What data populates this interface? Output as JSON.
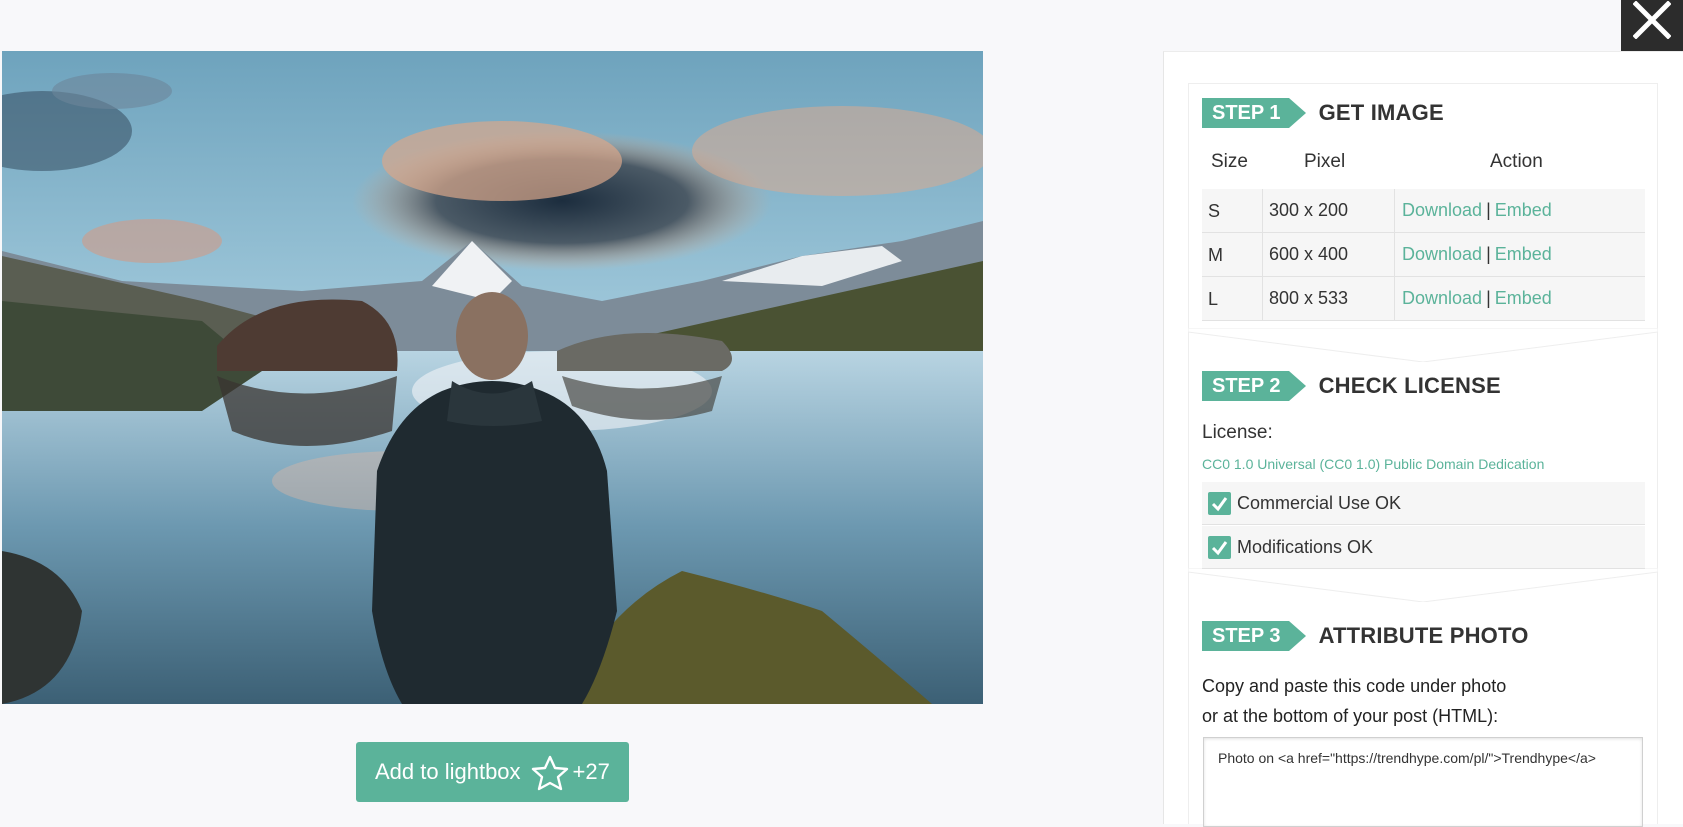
{
  "close": {
    "icon": "close-icon"
  },
  "lightbox": {
    "label": "Add to lightbox",
    "icon": "star-outline-icon",
    "count": "+27"
  },
  "step1": {
    "tag": "STEP 1",
    "title": "GET IMAGE",
    "headers": {
      "size": "Size",
      "pixel": "Pixel",
      "action": "Action"
    },
    "rows": [
      {
        "size": "S",
        "pixel": "300 x 200",
        "download": "Download",
        "sep": "|",
        "embed": "Embed"
      },
      {
        "size": "M",
        "pixel": "600 x 400",
        "download": "Download",
        "sep": "|",
        "embed": "Embed"
      },
      {
        "size": "L",
        "pixel": "800 x 533",
        "download": "Download",
        "sep": "|",
        "embed": "Embed"
      }
    ]
  },
  "step2": {
    "tag": "STEP 2",
    "title": "CHECK LICENSE",
    "license_label": "License:",
    "license_link": "CC0 1.0 Universal (CC0 1.0) Public Domain Dedication",
    "checks": [
      {
        "label": "Commercial Use OK"
      },
      {
        "label": "Modifications OK"
      }
    ]
  },
  "step3": {
    "tag": "STEP 3",
    "title": "ATTRIBUTE PHOTO",
    "line1": "Copy and paste this code under photo",
    "line2": "or at the bottom of your post (HTML):",
    "code": "Photo on <a href=\"https://trendhype.com/pl/\">Trendhype</a>"
  },
  "colors": {
    "accent": "#5bb39a",
    "close_bg": "#2c2c2c"
  }
}
